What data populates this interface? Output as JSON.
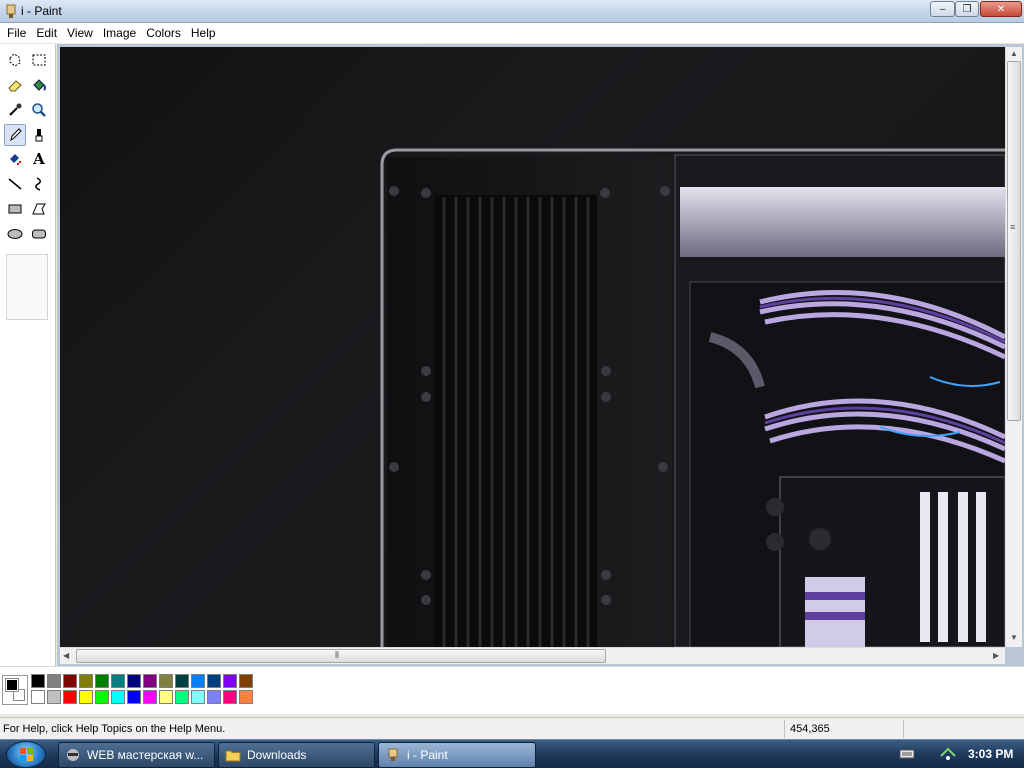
{
  "window": {
    "title": "i - Paint",
    "controls": {
      "minimize": "–",
      "maximize": "❐",
      "close": "✕"
    }
  },
  "menu": [
    "File",
    "Edit",
    "View",
    "Image",
    "Colors",
    "Help"
  ],
  "tools": [
    {
      "name": "free-select-tool",
      "icon": "free-select-icon"
    },
    {
      "name": "rect-select-tool",
      "icon": "rect-select-icon"
    },
    {
      "name": "eraser-tool",
      "icon": "eraser-icon"
    },
    {
      "name": "fill-tool",
      "icon": "paint-bucket-icon"
    },
    {
      "name": "color-picker-tool",
      "icon": "eyedropper-icon"
    },
    {
      "name": "magnifier-tool",
      "icon": "magnifier-icon"
    },
    {
      "name": "pencil-tool",
      "icon": "pencil-icon",
      "active": true
    },
    {
      "name": "brush-tool",
      "icon": "brush-icon"
    },
    {
      "name": "airbrush-tool",
      "icon": "airbrush-icon"
    },
    {
      "name": "text-tool",
      "icon": "text-icon",
      "glyph": "A"
    },
    {
      "name": "line-tool",
      "icon": "line-icon"
    },
    {
      "name": "curve-tool",
      "icon": "curve-icon"
    },
    {
      "name": "rectangle-tool",
      "icon": "rectangle-icon"
    },
    {
      "name": "polygon-tool",
      "icon": "polygon-icon"
    },
    {
      "name": "ellipse-tool",
      "icon": "ellipse-icon"
    },
    {
      "name": "rounded-rect-tool",
      "icon": "rounded-rectangle-icon"
    }
  ],
  "colors": {
    "foreground": "#000000",
    "background": "#ffffff",
    "palette_top": [
      "#000000",
      "#808080",
      "#800000",
      "#808000",
      "#008000",
      "#008080",
      "#000080",
      "#800080",
      "#808040",
      "#004040",
      "#0080ff",
      "#004080",
      "#8000ff",
      "#804000"
    ],
    "palette_bottom": [
      "#ffffff",
      "#c0c0c0",
      "#ff0000",
      "#ffff00",
      "#00ff00",
      "#00ffff",
      "#0000ff",
      "#ff00ff",
      "#ffff80",
      "#00ff80",
      "#80ffff",
      "#8080ff",
      "#ff0080",
      "#ff8040"
    ]
  },
  "status": {
    "help": "For Help, click Help Topics on the Help Menu.",
    "coords": "454,365"
  },
  "taskbar": {
    "items": [
      {
        "label": "WEB мастерская w...",
        "icon": "raccoon-app-icon",
        "active": false
      },
      {
        "label": "Downloads",
        "icon": "folder-icon",
        "active": false
      },
      {
        "label": "i - Paint",
        "icon": "paint-app-icon",
        "active": true
      }
    ],
    "clock": "3:03 PM"
  }
}
